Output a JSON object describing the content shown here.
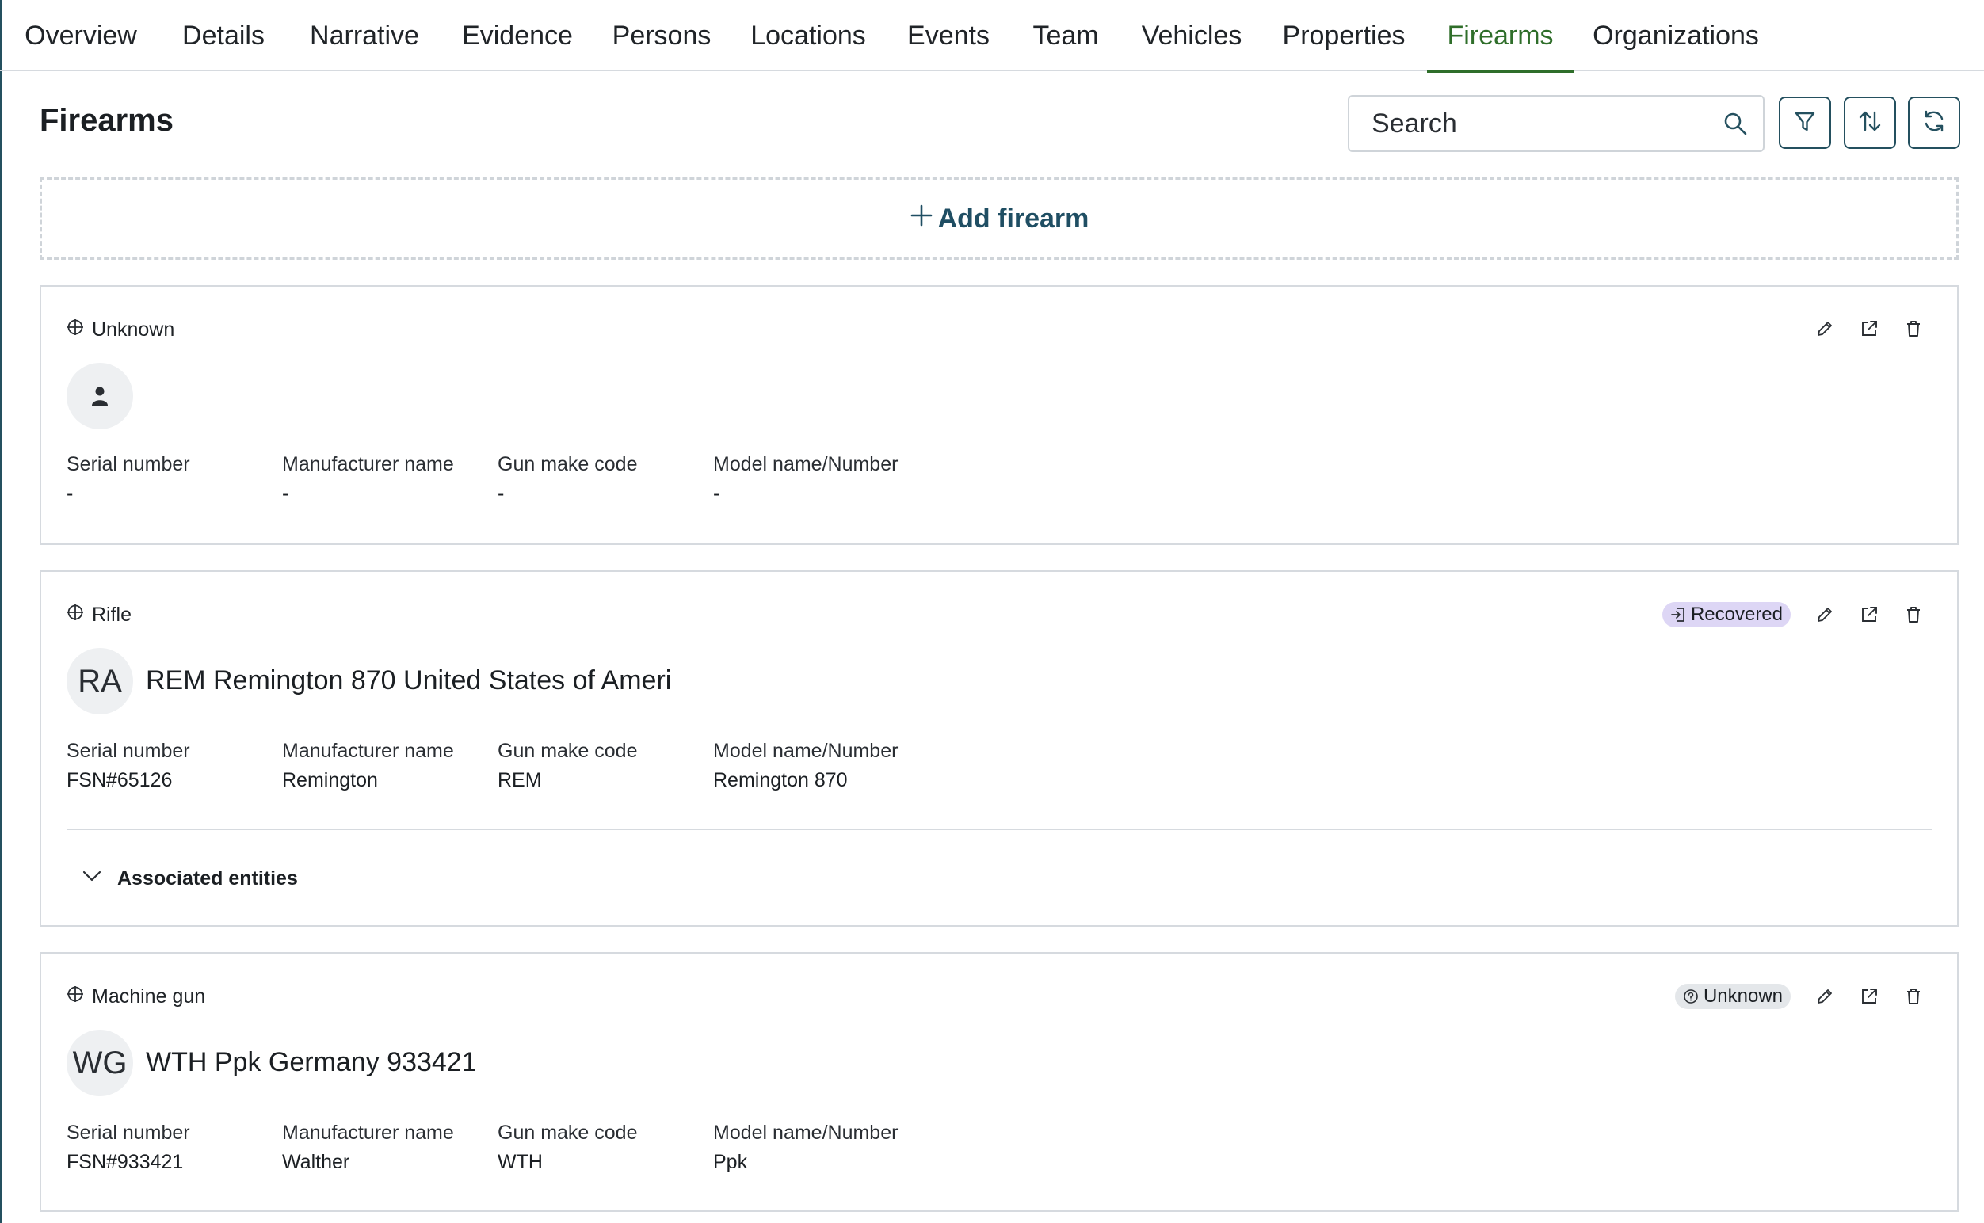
{
  "tabs": [
    {
      "label": "Overview"
    },
    {
      "label": "Details"
    },
    {
      "label": "Narrative"
    },
    {
      "label": "Evidence"
    },
    {
      "label": "Persons"
    },
    {
      "label": "Locations"
    },
    {
      "label": "Events"
    },
    {
      "label": "Team"
    },
    {
      "label": "Vehicles"
    },
    {
      "label": "Properties"
    },
    {
      "label": "Firearms",
      "active": true
    },
    {
      "label": "Organizations"
    }
  ],
  "header": {
    "title": "Firearms",
    "search_placeholder": "Search"
  },
  "toolbar_icons": [
    "filter-icon",
    "sort-icon",
    "refresh-icon"
  ],
  "add_label": "Add firearm",
  "field_labels": {
    "serial": "Serial number",
    "manufacturer": "Manufacturer name",
    "make_code": "Gun make code",
    "model": "Model name/Number"
  },
  "cards": [
    {
      "type": "Unknown",
      "avatar_icon": "person-icon",
      "title": "",
      "status": "",
      "serial": "-",
      "manufacturer": "-",
      "make_code": "-",
      "model": "-"
    },
    {
      "type": "Rifle",
      "avatar_initials": "RA",
      "title": "REM Remington 870 United States of Ameri",
      "status": "Recovered",
      "serial": "FSN#65126",
      "manufacturer": "Remington",
      "make_code": "REM",
      "model": "Remington 870",
      "associated_label": "Associated entities"
    },
    {
      "type": "Machine gun",
      "avatar_initials": "WG",
      "title": "WTH Ppk Germany 933421",
      "status": "Unknown",
      "serial": "FSN#933421",
      "manufacturer": "Walther",
      "make_code": "WTH",
      "model": "Ppk"
    }
  ],
  "colors": {
    "accent_green": "#2f6e2a",
    "primary_teal": "#24505f",
    "recovered_badge": "#ddd6f5",
    "unknown_badge": "#e4e7ea"
  }
}
